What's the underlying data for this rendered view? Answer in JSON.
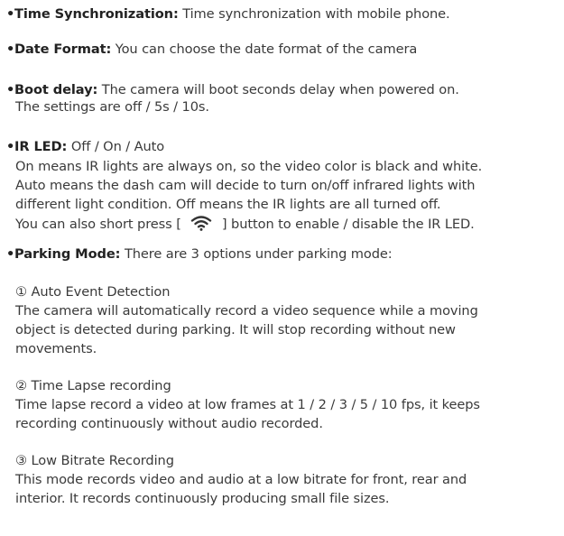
{
  "bullet": "•",
  "items": [
    {
      "term": "Time Synchronization:",
      "desc": " Time synchronization with mobile phone."
    },
    {
      "term": "Date Format:",
      "desc": " You can choose the date format of the camera"
    },
    {
      "term": "Boot delay:",
      "desc": " The camera will boot seconds delay when powered on.",
      "lines": [
        "The settings are off  / 5s / 10s."
      ]
    },
    {
      "term": "IR LED:",
      "desc": " Off / On / Auto",
      "lines": [
        "On means IR lights are always on, so the video color is black and white.",
        "Auto means the dash cam will decide to turn on/off infrared lights with",
        "different light condition. Off means the IR lights are all turned off."
      ],
      "short_press_before": "You can also short press [",
      "short_press_icon": "wifi-icon",
      "short_press_after": "] button to enable / disable the IR LED."
    },
    {
      "term": "Parking Mode:",
      "desc": " There are 3 options under parking mode:"
    }
  ],
  "parking_options": [
    {
      "heading": "① Auto Event Detection",
      "lines": [
        "The camera will automatically record a video sequence while a moving",
        "object is detected during parking. It will stop recording without new",
        "movements."
      ]
    },
    {
      "heading": "② Time Lapse recording",
      "lines": [
        "Time lapse record a video at low frames at 1 / 2 / 3 / 5 / 10 fps, it keeps",
        "recording continuously without audio recorded."
      ]
    },
    {
      "heading": "③ Low Bitrate Recording",
      "lines": [
        "This mode records video and audio at a low bitrate for front, rear and",
        "interior. It records continuously producing small file sizes."
      ]
    }
  ]
}
